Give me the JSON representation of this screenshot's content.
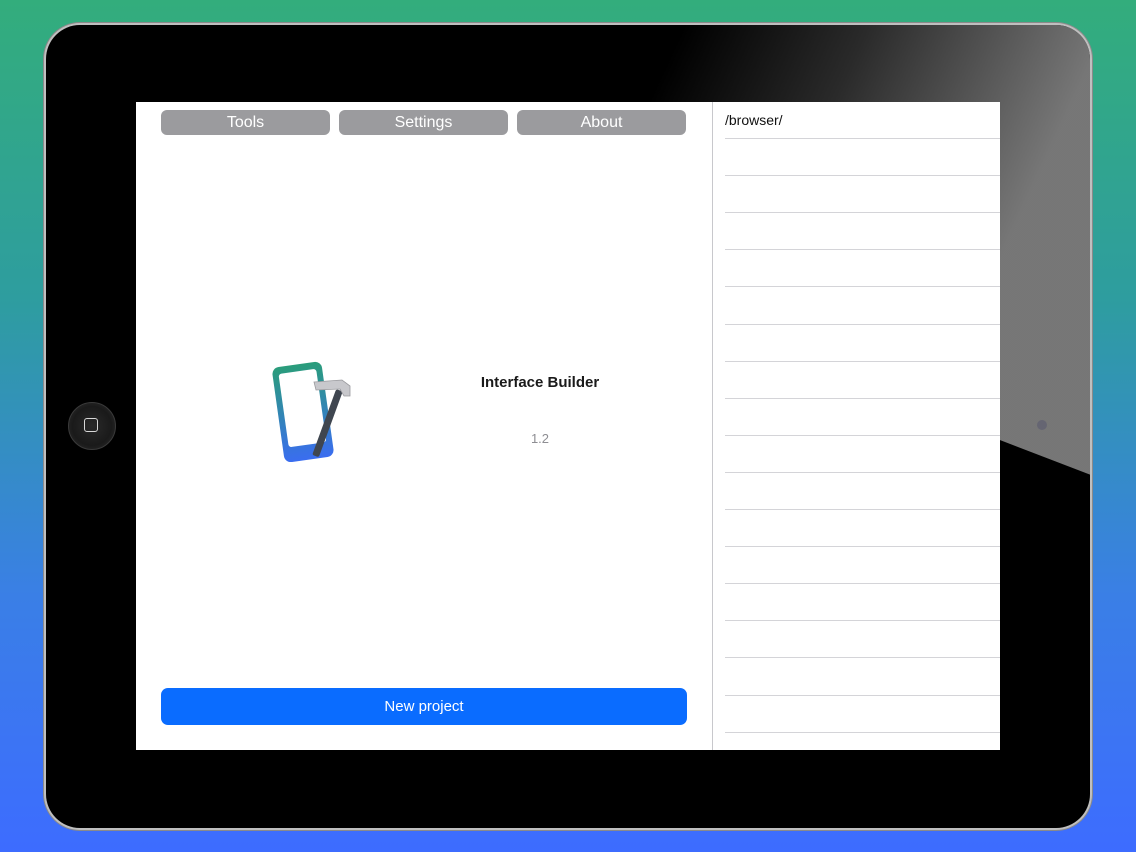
{
  "tabs": [
    {
      "label": "Tools"
    },
    {
      "label": "Settings"
    },
    {
      "label": "About"
    }
  ],
  "about": {
    "app_icon": "phone-hammer-icon",
    "app_name": "Interface Builder",
    "version": "1.2"
  },
  "actions": {
    "new_project_label": "New project"
  },
  "browser": {
    "path": "/browser/",
    "empty_rows": 17
  },
  "colors": {
    "tab_background": "#9b9b9e",
    "primary_button": "#0a6cff",
    "background_top": "#33ad7c",
    "background_bottom": "#3d6cff"
  }
}
